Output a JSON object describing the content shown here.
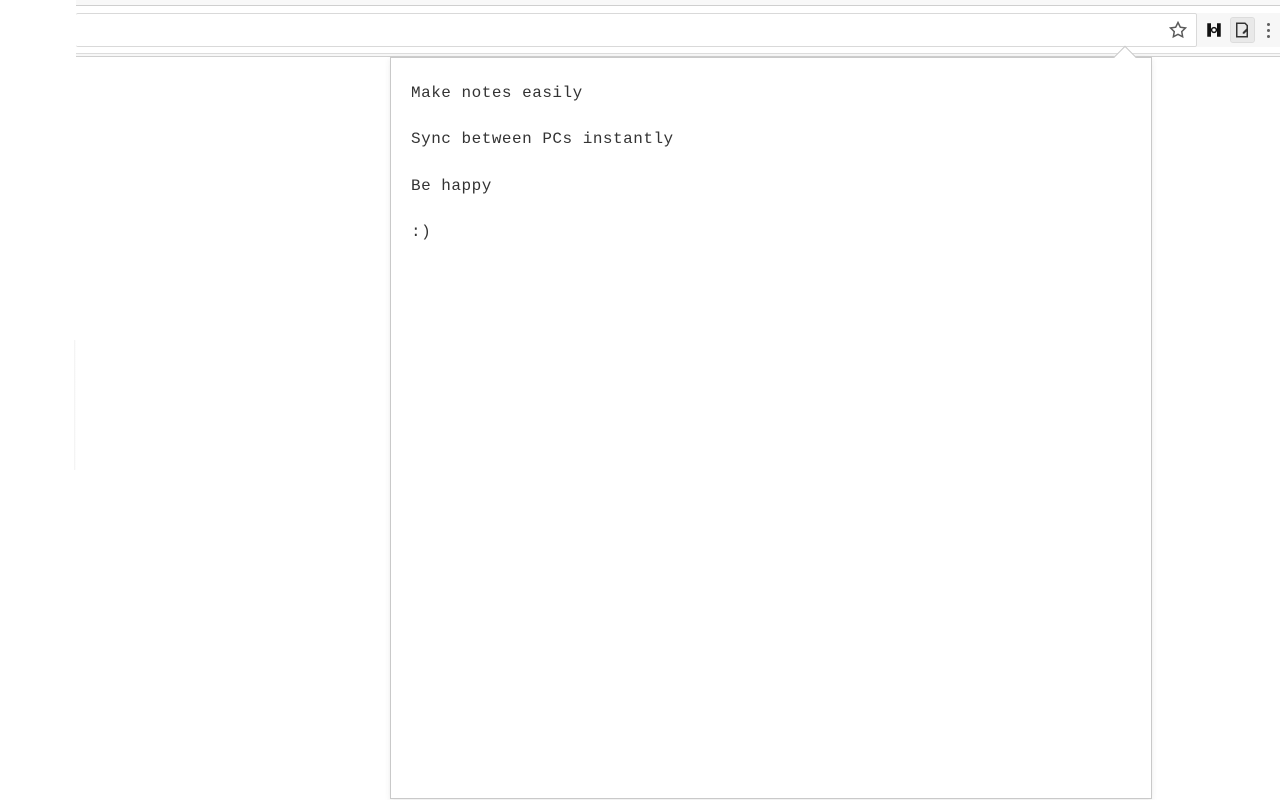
{
  "toolbar": {
    "star_title": "Bookmark this page",
    "menu_title": "Customize and control"
  },
  "extensions": [
    {
      "name": "extension-1-icon"
    },
    {
      "name": "notes-extension-icon"
    }
  ],
  "popup": {
    "lines": [
      "Make notes easily",
      "Sync between PCs instantly",
      "Be happy",
      ":)"
    ]
  }
}
